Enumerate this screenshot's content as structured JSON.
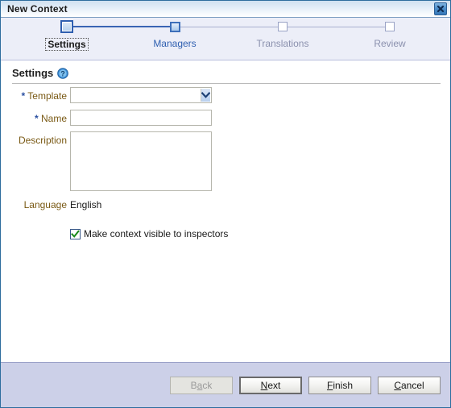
{
  "window": {
    "title": "New Context",
    "close_icon": "close-icon"
  },
  "wizard": {
    "steps": [
      {
        "label": "Settings",
        "state": "active"
      },
      {
        "label": "Managers",
        "state": "visited"
      },
      {
        "label": "Translations",
        "state": "inactive"
      },
      {
        "label": "Review",
        "state": "inactive"
      }
    ]
  },
  "settings": {
    "section_title": "Settings",
    "help_icon": "help-icon",
    "fields": {
      "template": {
        "label": "Template",
        "required_marker": "*",
        "value": "",
        "placeholder": "",
        "dropdown_icon": "chevron-down-icon"
      },
      "name": {
        "label": "Name",
        "required_marker": "*",
        "value": "",
        "placeholder": ""
      },
      "description": {
        "label": "Description",
        "value": "",
        "placeholder": ""
      },
      "language": {
        "label": "Language",
        "value": "English"
      },
      "visible_to_inspectors": {
        "label": "Make context visible to inspectors",
        "checked": true,
        "check_icon": "check-icon"
      }
    }
  },
  "buttons": {
    "back": {
      "label_pre": "B",
      "label_mn": "a",
      "label_post": "ck",
      "disabled": true
    },
    "next": {
      "label_pre": "",
      "label_mn": "N",
      "label_post": "ext",
      "default": true
    },
    "finish": {
      "label_pre": "",
      "label_mn": "F",
      "label_post": "inish"
    },
    "cancel": {
      "label_pre": "",
      "label_mn": "C",
      "label_post": "ancel"
    }
  },
  "colors": {
    "accent_blue": "#2f5fb0",
    "label_brown": "#7a5a15",
    "header_band": "#eceef8",
    "button_bar": "#ccd0e8",
    "title_border": "#2e6d9e"
  }
}
